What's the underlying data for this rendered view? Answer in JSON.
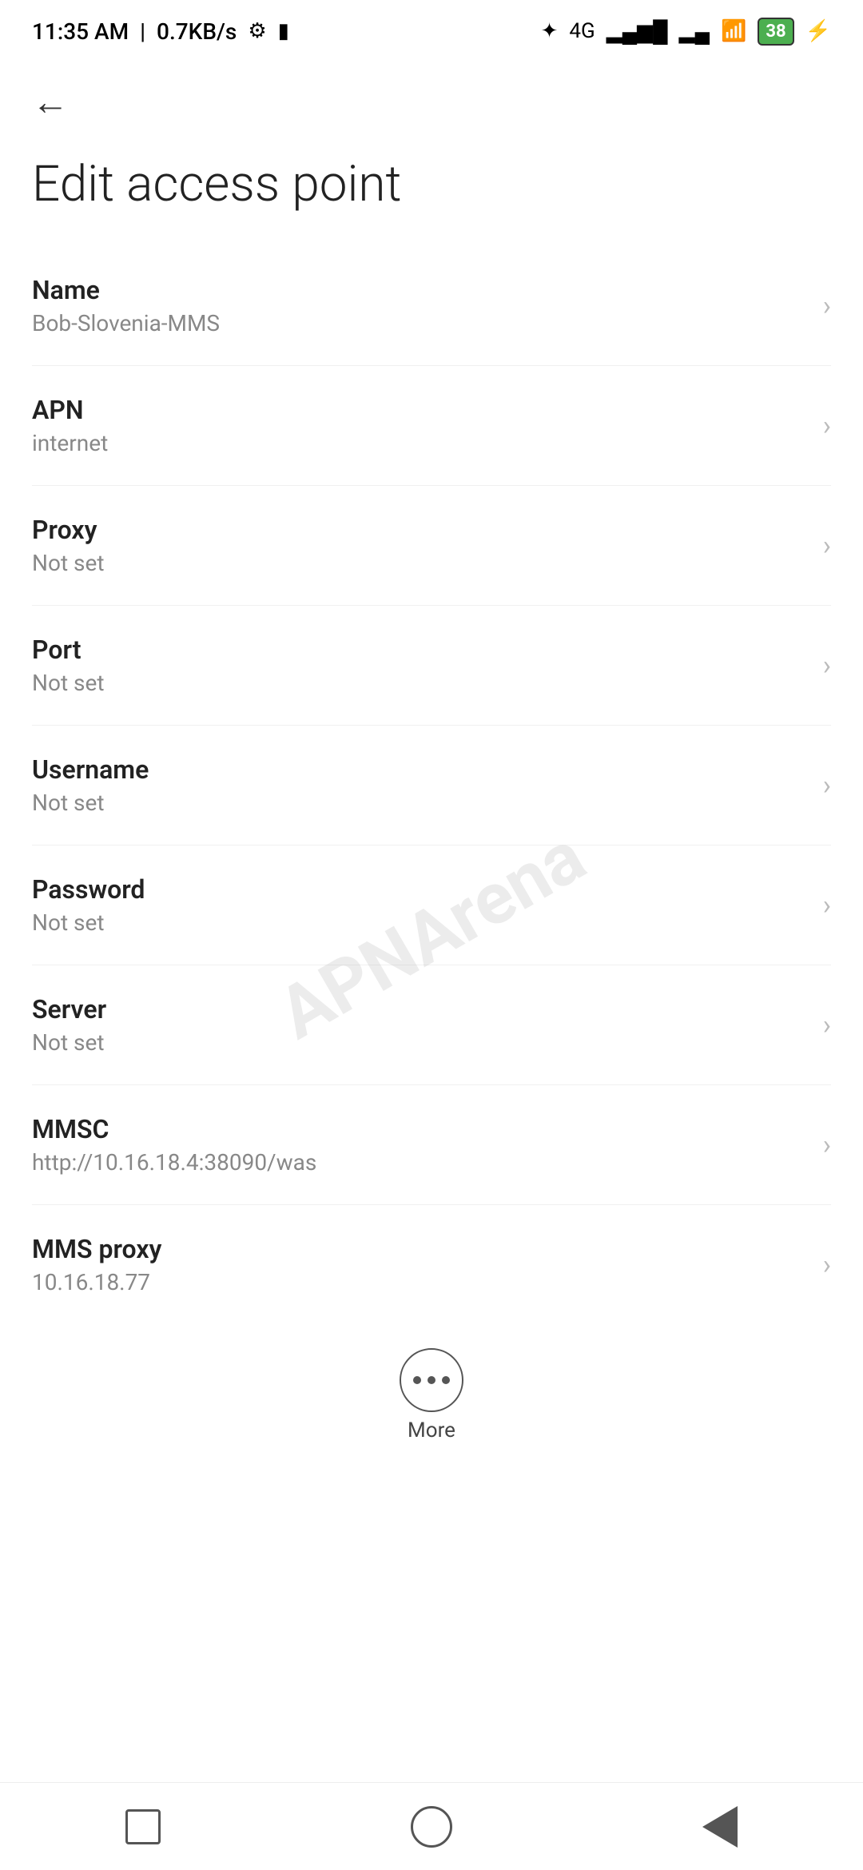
{
  "statusBar": {
    "time": "11:35 AM",
    "speed": "0.7KB/s",
    "battery": "38"
  },
  "nav": {
    "back_label": "←"
  },
  "page": {
    "title": "Edit access point"
  },
  "settings": [
    {
      "label": "Name",
      "value": "Bob-Slovenia-MMS"
    },
    {
      "label": "APN",
      "value": "internet"
    },
    {
      "label": "Proxy",
      "value": "Not set"
    },
    {
      "label": "Port",
      "value": "Not set"
    },
    {
      "label": "Username",
      "value": "Not set"
    },
    {
      "label": "Password",
      "value": "Not set"
    },
    {
      "label": "Server",
      "value": "Not set"
    },
    {
      "label": "MMSC",
      "value": "http://10.16.18.4:38090/was"
    },
    {
      "label": "MMS proxy",
      "value": "10.16.18.77"
    }
  ],
  "more": {
    "label": "More"
  },
  "watermark": "APNArena"
}
